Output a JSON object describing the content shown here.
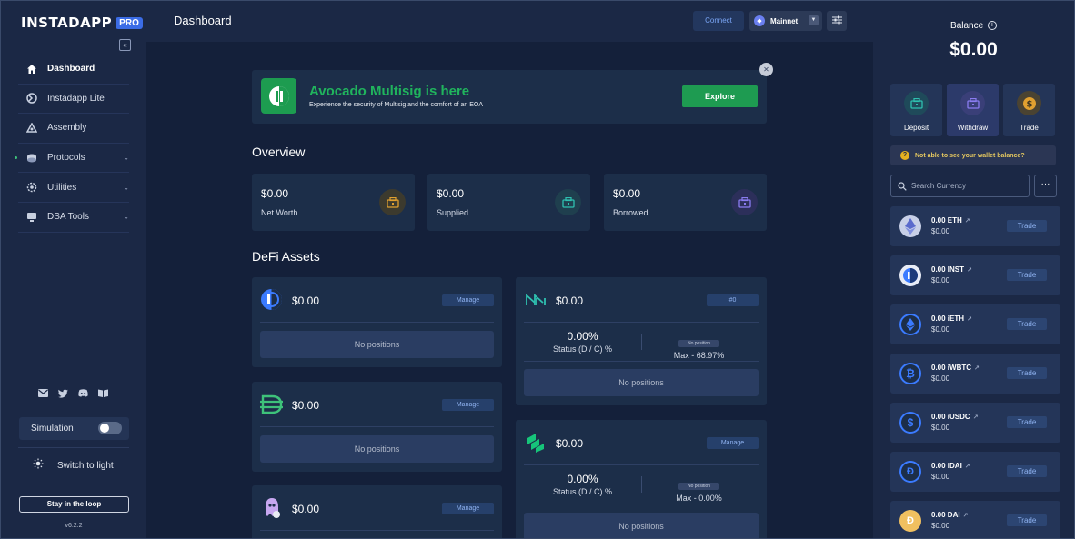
{
  "app": {
    "logo_text": "INSTADAPP",
    "logo_badge": "PRO",
    "version": "v6.2.2"
  },
  "sidebar": {
    "items": [
      {
        "label": "Dashboard",
        "icon": "home-icon",
        "active": true,
        "has_chevron": false
      },
      {
        "label": "Instadapp Lite",
        "icon": "lite-icon",
        "active": false,
        "has_chevron": false
      },
      {
        "label": "Assembly",
        "icon": "assembly-icon",
        "active": false,
        "has_chevron": false
      },
      {
        "label": "Protocols",
        "icon": "protocols-icon",
        "active": false,
        "has_chevron": true
      },
      {
        "label": "Utilities",
        "icon": "utilities-icon",
        "active": false,
        "has_chevron": true
      },
      {
        "label": "DSA Tools",
        "icon": "dsa-icon",
        "active": false,
        "has_chevron": true
      }
    ],
    "social": [
      "mail-icon",
      "twitter-icon",
      "discord-icon",
      "docs-icon"
    ],
    "simulation_label": "Simulation",
    "switch_theme_label": "Switch to light",
    "loop_button": "Stay in the loop"
  },
  "header": {
    "title": "Dashboard",
    "connect_label": "Connect",
    "network_label": "Mainnet"
  },
  "promo": {
    "title": "Avocado Multisig is here",
    "subtitle": "Experience the security of Multisig and the comfort of an EOA",
    "button": "Explore"
  },
  "overview": {
    "title": "Overview",
    "cards": [
      {
        "value": "$0.00",
        "label": "Net Worth",
        "color": "#e0a030"
      },
      {
        "value": "$0.00",
        "label": "Supplied",
        "color": "#2fc0b0"
      },
      {
        "value": "$0.00",
        "label": "Borrowed",
        "color": "#8a7cf0"
      }
    ]
  },
  "defi": {
    "title": "DeFi Assets",
    "left": [
      {
        "protocol": "instadapp",
        "value": "$0.00",
        "button": "Manage",
        "empty": "No positions"
      },
      {
        "protocol": "liquity",
        "value": "$0.00",
        "button": "Manage",
        "empty": "No positions"
      },
      {
        "protocol": "reflexer",
        "value": "$0.00",
        "button": "Manage"
      }
    ],
    "right": [
      {
        "protocol": "maker",
        "value": "$0.00",
        "button": "#0",
        "status_value": "0.00%",
        "status_label": "Status (D / C) %",
        "badge": "No position",
        "max_label": "Max - 68.97%",
        "empty": "No positions"
      },
      {
        "protocol": "compound",
        "value": "$0.00",
        "button": "Manage",
        "status_value": "0.00%",
        "status_label": "Status (D / C) %",
        "badge": "No position",
        "max_label": "Max - 0.00%",
        "empty": "No positions"
      }
    ]
  },
  "wallet": {
    "balance_label": "Balance",
    "balance_value": "$0.00",
    "actions": [
      {
        "label": "Deposit",
        "color": "#2fc0b0"
      },
      {
        "label": "Withdraw",
        "color": "#8a7cf0"
      },
      {
        "label": "Trade",
        "color": "#e0a030"
      }
    ],
    "warning": "Not able to see your wallet balance?",
    "search_placeholder": "Search Currency",
    "trade_label": "Trade",
    "coins": [
      {
        "amount": "0.00 ETH",
        "usd": "$0.00",
        "icon": "eth-icon"
      },
      {
        "amount": "0.00 INST",
        "usd": "$0.00",
        "icon": "inst-icon"
      },
      {
        "amount": "0.00 iETH",
        "usd": "$0.00",
        "icon": "ieth-icon"
      },
      {
        "amount": "0.00 iWBTC",
        "usd": "$0.00",
        "icon": "iwbtc-icon"
      },
      {
        "amount": "0.00 iUSDC",
        "usd": "$0.00",
        "icon": "iusdc-icon"
      },
      {
        "amount": "0.00 iDAI",
        "usd": "$0.00",
        "icon": "idai-icon"
      },
      {
        "amount": "0.00 DAI",
        "usd": "$0.00",
        "icon": "dai-icon"
      }
    ]
  }
}
